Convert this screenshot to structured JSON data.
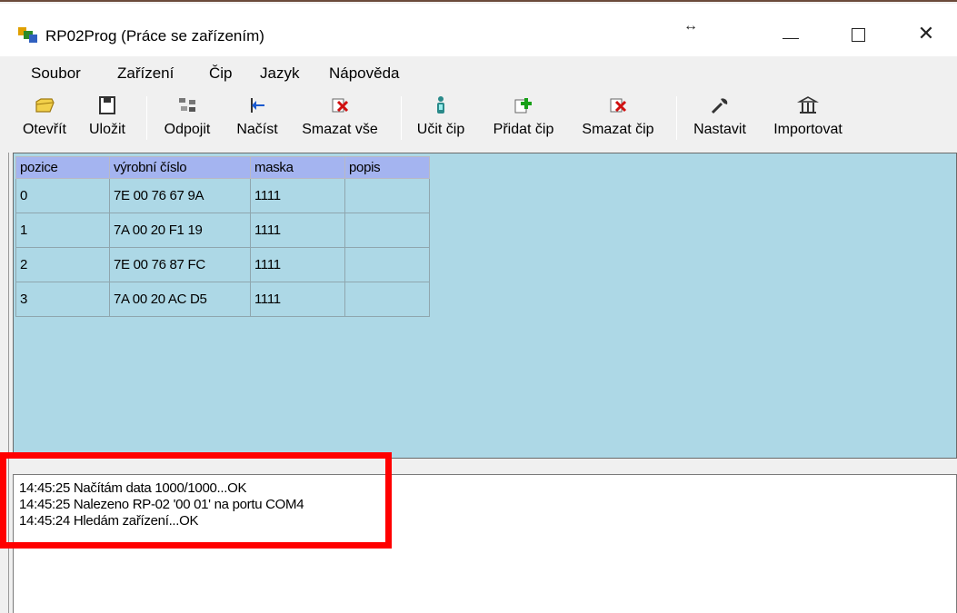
{
  "window": {
    "title": "RP02Prog (Práce se zařízením)",
    "icons": {
      "app": "app-chip-icon",
      "resize": "resize-horizontal-icon"
    },
    "controls": {
      "minimize": "minimize-icon",
      "maximize": "maximize-icon",
      "close": "✕"
    }
  },
  "menu": {
    "items": [
      {
        "label": "Soubor"
      },
      {
        "label": "Zařízení"
      },
      {
        "label": "Čip"
      },
      {
        "label": "Jazyk"
      },
      {
        "label": "Nápověda"
      }
    ]
  },
  "toolbar": {
    "items": [
      {
        "label": "Otevřít",
        "icon": "open-folder-icon"
      },
      {
        "label": "Uložit",
        "icon": "save-disk-icon"
      },
      {
        "label": "Odpojit",
        "icon": "disconnect-icon"
      },
      {
        "label": "Načíst",
        "icon": "load-arrow-icon"
      },
      {
        "label": "Smazat vše",
        "icon": "delete-all-icon"
      },
      {
        "label": "Učit čip",
        "icon": "learn-chip-person-icon"
      },
      {
        "label": "Přidat čip",
        "icon": "add-chip-icon"
      },
      {
        "label": "Smazat čip",
        "icon": "delete-chip-icon"
      },
      {
        "label": "Nastavit",
        "icon": "wrench-icon"
      },
      {
        "label": "Importovat",
        "icon": "import-building-icon"
      }
    ]
  },
  "grid": {
    "columns": [
      "pozice",
      "výrobní číslo",
      "maska",
      "popis"
    ],
    "rows": [
      [
        "0",
        "7E 00 76 67 9A",
        "1111",
        ""
      ],
      [
        "1",
        "7A 00 20 F1 19",
        "1111",
        ""
      ],
      [
        "2",
        "7E 00 76 87 FC",
        "1111",
        ""
      ],
      [
        "3",
        "7A 00 20 AC D5",
        "1111",
        ""
      ]
    ],
    "colors": {
      "background": "#add8e6",
      "header": "#a4b4f0"
    }
  },
  "log": {
    "lines": [
      "14:45:25  Načítám data 1000/1000...OK",
      "14:45:25  Nalezeno RP-02 '00 01' na portu COM4",
      "14:45:24  Hledám zařízení...OK"
    ]
  },
  "highlight": {
    "color": "#ff0000"
  }
}
